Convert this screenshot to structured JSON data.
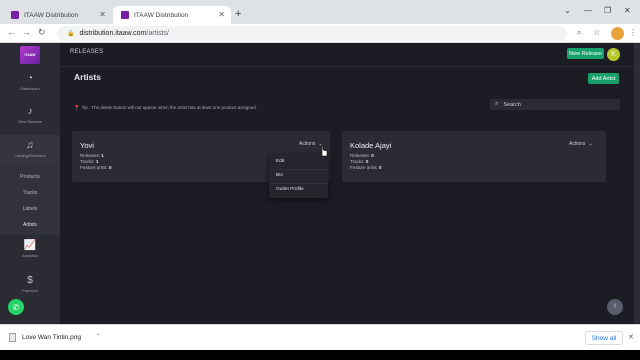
{
  "browser": {
    "tabs": [
      {
        "title": "ITAAW Distribution",
        "active": false
      },
      {
        "title": "ITAAW Distribution",
        "active": true
      }
    ],
    "url_domain": "distribution.itaaw.com",
    "url_path": "/artists/"
  },
  "app": {
    "logo_text": "ITAAW",
    "sidebar": {
      "items": [
        {
          "label": "Dashboard",
          "icon": "dashboard-icon"
        },
        {
          "label": "New Release",
          "icon": "music-note-icon"
        },
        {
          "label": "Catalog/Releases",
          "icon": "catalog-icon"
        },
        {
          "label": "Analytics",
          "icon": "chart-icon"
        },
        {
          "label": "Payment",
          "icon": "dollar-icon"
        }
      ],
      "subitems": [
        "Products",
        "Tracks",
        "Labels",
        "Artists"
      ]
    },
    "top_label": "RELEASES",
    "new_release_label": "New Release",
    "avatar_letter": "K",
    "page_title": "Artists",
    "add_artist_label": "Add Artist",
    "tip": "Tip : The delete button will not appear when the artist has at least one product assigned.",
    "search_placeholder": "Search",
    "stat_labels": {
      "releases": "Releases:",
      "tracks": "Tracks:",
      "feature": "Feature artist:"
    },
    "artists": [
      {
        "name": "Yovi",
        "releases": "1",
        "tracks": "1",
        "feature_artist": "0",
        "actions_label": "Actions"
      },
      {
        "name": "Kolade Ajayi",
        "releases": "0",
        "tracks": "0",
        "feature_artist": "0",
        "actions_label": "Actions"
      }
    ],
    "actions_menu": [
      "Edit",
      "Bio",
      "Outlet Profile"
    ],
    "fab_label": "!"
  },
  "downloads": {
    "file_name": "Love Wan Tintin.png",
    "show_all_label": "Show all"
  },
  "colors": {
    "accent_green": "#18a06b",
    "background": "#1c1d24",
    "card": "#2a2b33"
  }
}
